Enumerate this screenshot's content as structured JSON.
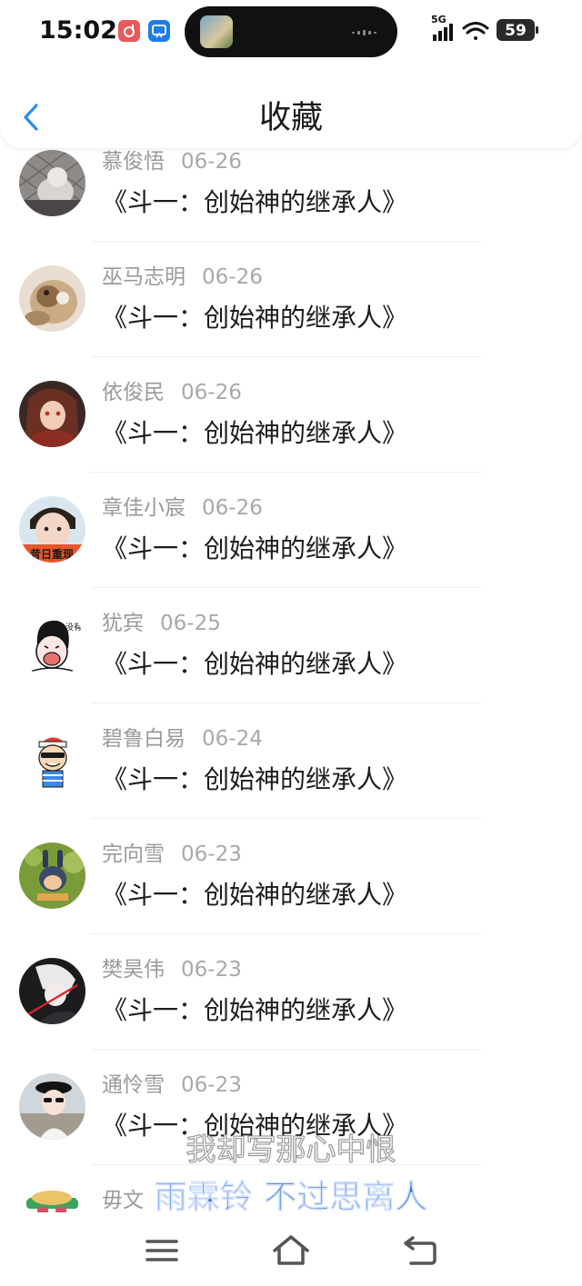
{
  "status_bar": {
    "time": "15:02",
    "network": "5G",
    "battery": "59"
  },
  "header": {
    "title": "收藏"
  },
  "items": [
    {
      "user": "慕俊悟",
      "date": "06-26",
      "title": "《斗一：创始神的继承人》"
    },
    {
      "user": "巫马志明",
      "date": "06-26",
      "title": "《斗一：创始神的继承人》"
    },
    {
      "user": "依俊民",
      "date": "06-26",
      "title": "《斗一：创始神的继承人》"
    },
    {
      "user": "章佳小宸",
      "date": "06-26",
      "title": "《斗一：创始神的继承人》"
    },
    {
      "user": "犹宾",
      "date": "06-25",
      "title": "《斗一：创始神的继承人》"
    },
    {
      "user": "碧鲁白易",
      "date": "06-24",
      "title": "《斗一：创始神的继承人》"
    },
    {
      "user": "完向雪",
      "date": "06-23",
      "title": "《斗一：创始神的继承人》"
    },
    {
      "user": "樊昊伟",
      "date": "06-23",
      "title": "《斗一：创始神的继承人》"
    },
    {
      "user": "通怜雪",
      "date": "06-23",
      "title": "《斗一：创始神的继承人》"
    },
    {
      "user": "毋文",
      "date": "",
      "title": ""
    }
  ],
  "overlay": {
    "subtitle_line1": "我却写那心中恨",
    "subtitle_line2": "雨霖铃 不过思离人"
  },
  "colors": {
    "accent": "#2a8ce8",
    "title_text": "#1c1c1c",
    "meta_text": "#9a9a9a",
    "subtitle_blue": "#2f6fe0"
  },
  "icons": {
    "back": "chevron-left-icon",
    "menu": "menu-icon",
    "home": "home-icon",
    "return": "return-icon"
  }
}
